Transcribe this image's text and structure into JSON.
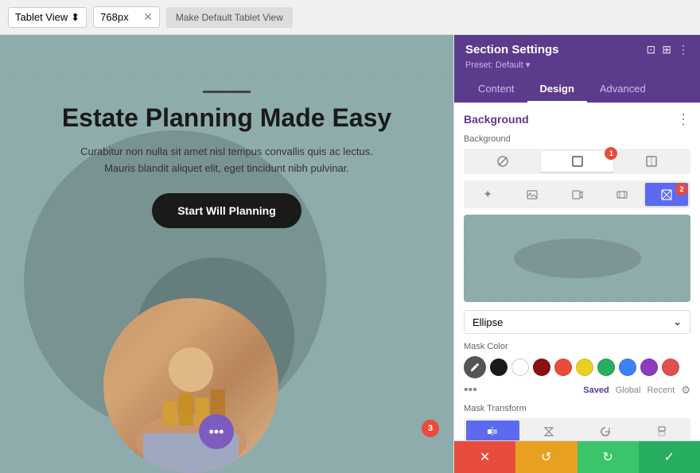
{
  "topbar": {
    "view_label": "Tablet View",
    "px_value": "768px",
    "make_default_label": "Make Default Tablet View"
  },
  "panel": {
    "title": "Section Settings",
    "preset_label": "Preset: Default ▾",
    "tabs": [
      "Content",
      "Design",
      "Advanced"
    ],
    "active_tab": "Design",
    "background_section_title": "Background",
    "field_background_label": "Background",
    "bg_type_icons": [
      "☰",
      "□",
      "□"
    ],
    "bg_type_icons2": [
      "✦",
      "▤",
      "⊞",
      "⊟",
      "⊠"
    ],
    "shape_label": "Ellipse",
    "mask_color_label": "Mask Color",
    "mask_transform_label": "Mask Transform",
    "color_tabs": [
      "Saved",
      "Global",
      "Recent"
    ],
    "active_color_tab": "Saved",
    "footer_buttons": [
      "✕",
      "↺",
      "↻",
      "✓"
    ]
  },
  "badges": {
    "one": "1",
    "two": "2",
    "three": "3"
  },
  "canvas": {
    "title": "Estate Planning Made Easy",
    "subtitle": "Curabitur non nulla sit amet nisl tempus convallis quis ac lectus. Mauris blandit aliquet elit, eget tincidunt nibh pulvinar.",
    "button_label": "Start Will Planning"
  },
  "colors": {
    "primary_purple": "#5b3b8c",
    "tab_active_blue": "#5b6af0",
    "swatch_gray": "#666666",
    "swatch_black": "#1a1a1a",
    "swatch_white": "#ffffff",
    "swatch_darkred": "#8b1010",
    "swatch_red": "#e74c3c",
    "swatch_yellow": "#e8d020",
    "swatch_green": "#27ae60",
    "swatch_blue": "#3b82f6",
    "swatch_purple": "#8b3bbc",
    "swatch_pink_red": "#e05050"
  }
}
